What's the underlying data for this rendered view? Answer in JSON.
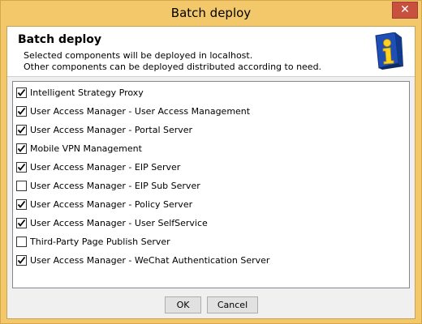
{
  "window": {
    "title": "Batch deploy",
    "close_glyph": "✕"
  },
  "header": {
    "title": "Batch deploy",
    "line1": "Selected components will be deployed in localhost.",
    "line2": "Other components can be deployed distributed according to need.",
    "icon": "info-icon"
  },
  "components": [
    {
      "label": "Intelligent Strategy Proxy",
      "checked": true
    },
    {
      "label": "User Access Manager - User Access Management",
      "checked": true
    },
    {
      "label": "User Access Manager - Portal Server",
      "checked": true
    },
    {
      "label": "Mobile VPN Management",
      "checked": true
    },
    {
      "label": "User Access Manager - EIP Server",
      "checked": true
    },
    {
      "label": "User Access Manager - EIP Sub Server",
      "checked": false
    },
    {
      "label": "User Access Manager - Policy Server",
      "checked": true
    },
    {
      "label": "User Access Manager - User SelfService",
      "checked": true
    },
    {
      "label": "Third-Party Page Publish Server",
      "checked": false
    },
    {
      "label": "User Access Manager - WeChat Authentication Server",
      "checked": true
    }
  ],
  "buttons": {
    "ok": "OK",
    "cancel": "Cancel"
  },
  "colors": {
    "titlebar": "#f3c86a",
    "close": "#c7503f",
    "list_border": "#828790"
  }
}
